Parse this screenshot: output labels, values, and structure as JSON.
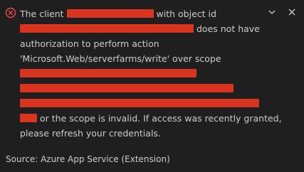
{
  "notification": {
    "severity_icon": "error-circle-x-icon",
    "message": {
      "line1_prefix": "The client",
      "line1_suffix": "with object id",
      "line2_suffix": "does not have",
      "line3": "authorization to perform action",
      "line4": "'Microsoft.Web/serverfarms/write' over scope",
      "line8_suffix": "or the scope is invalid. If access was recently granted,",
      "line9": "please refresh your credentials."
    },
    "source": "Source: Azure App Service (Extension)"
  },
  "actions": {
    "collapse_icon": "chevron-down-icon",
    "close_icon": "close-icon"
  },
  "colors": {
    "background": "#1f1f1f",
    "text": "#cccccc",
    "error_icon": "#f14c4c",
    "redaction": "#d9341f"
  }
}
